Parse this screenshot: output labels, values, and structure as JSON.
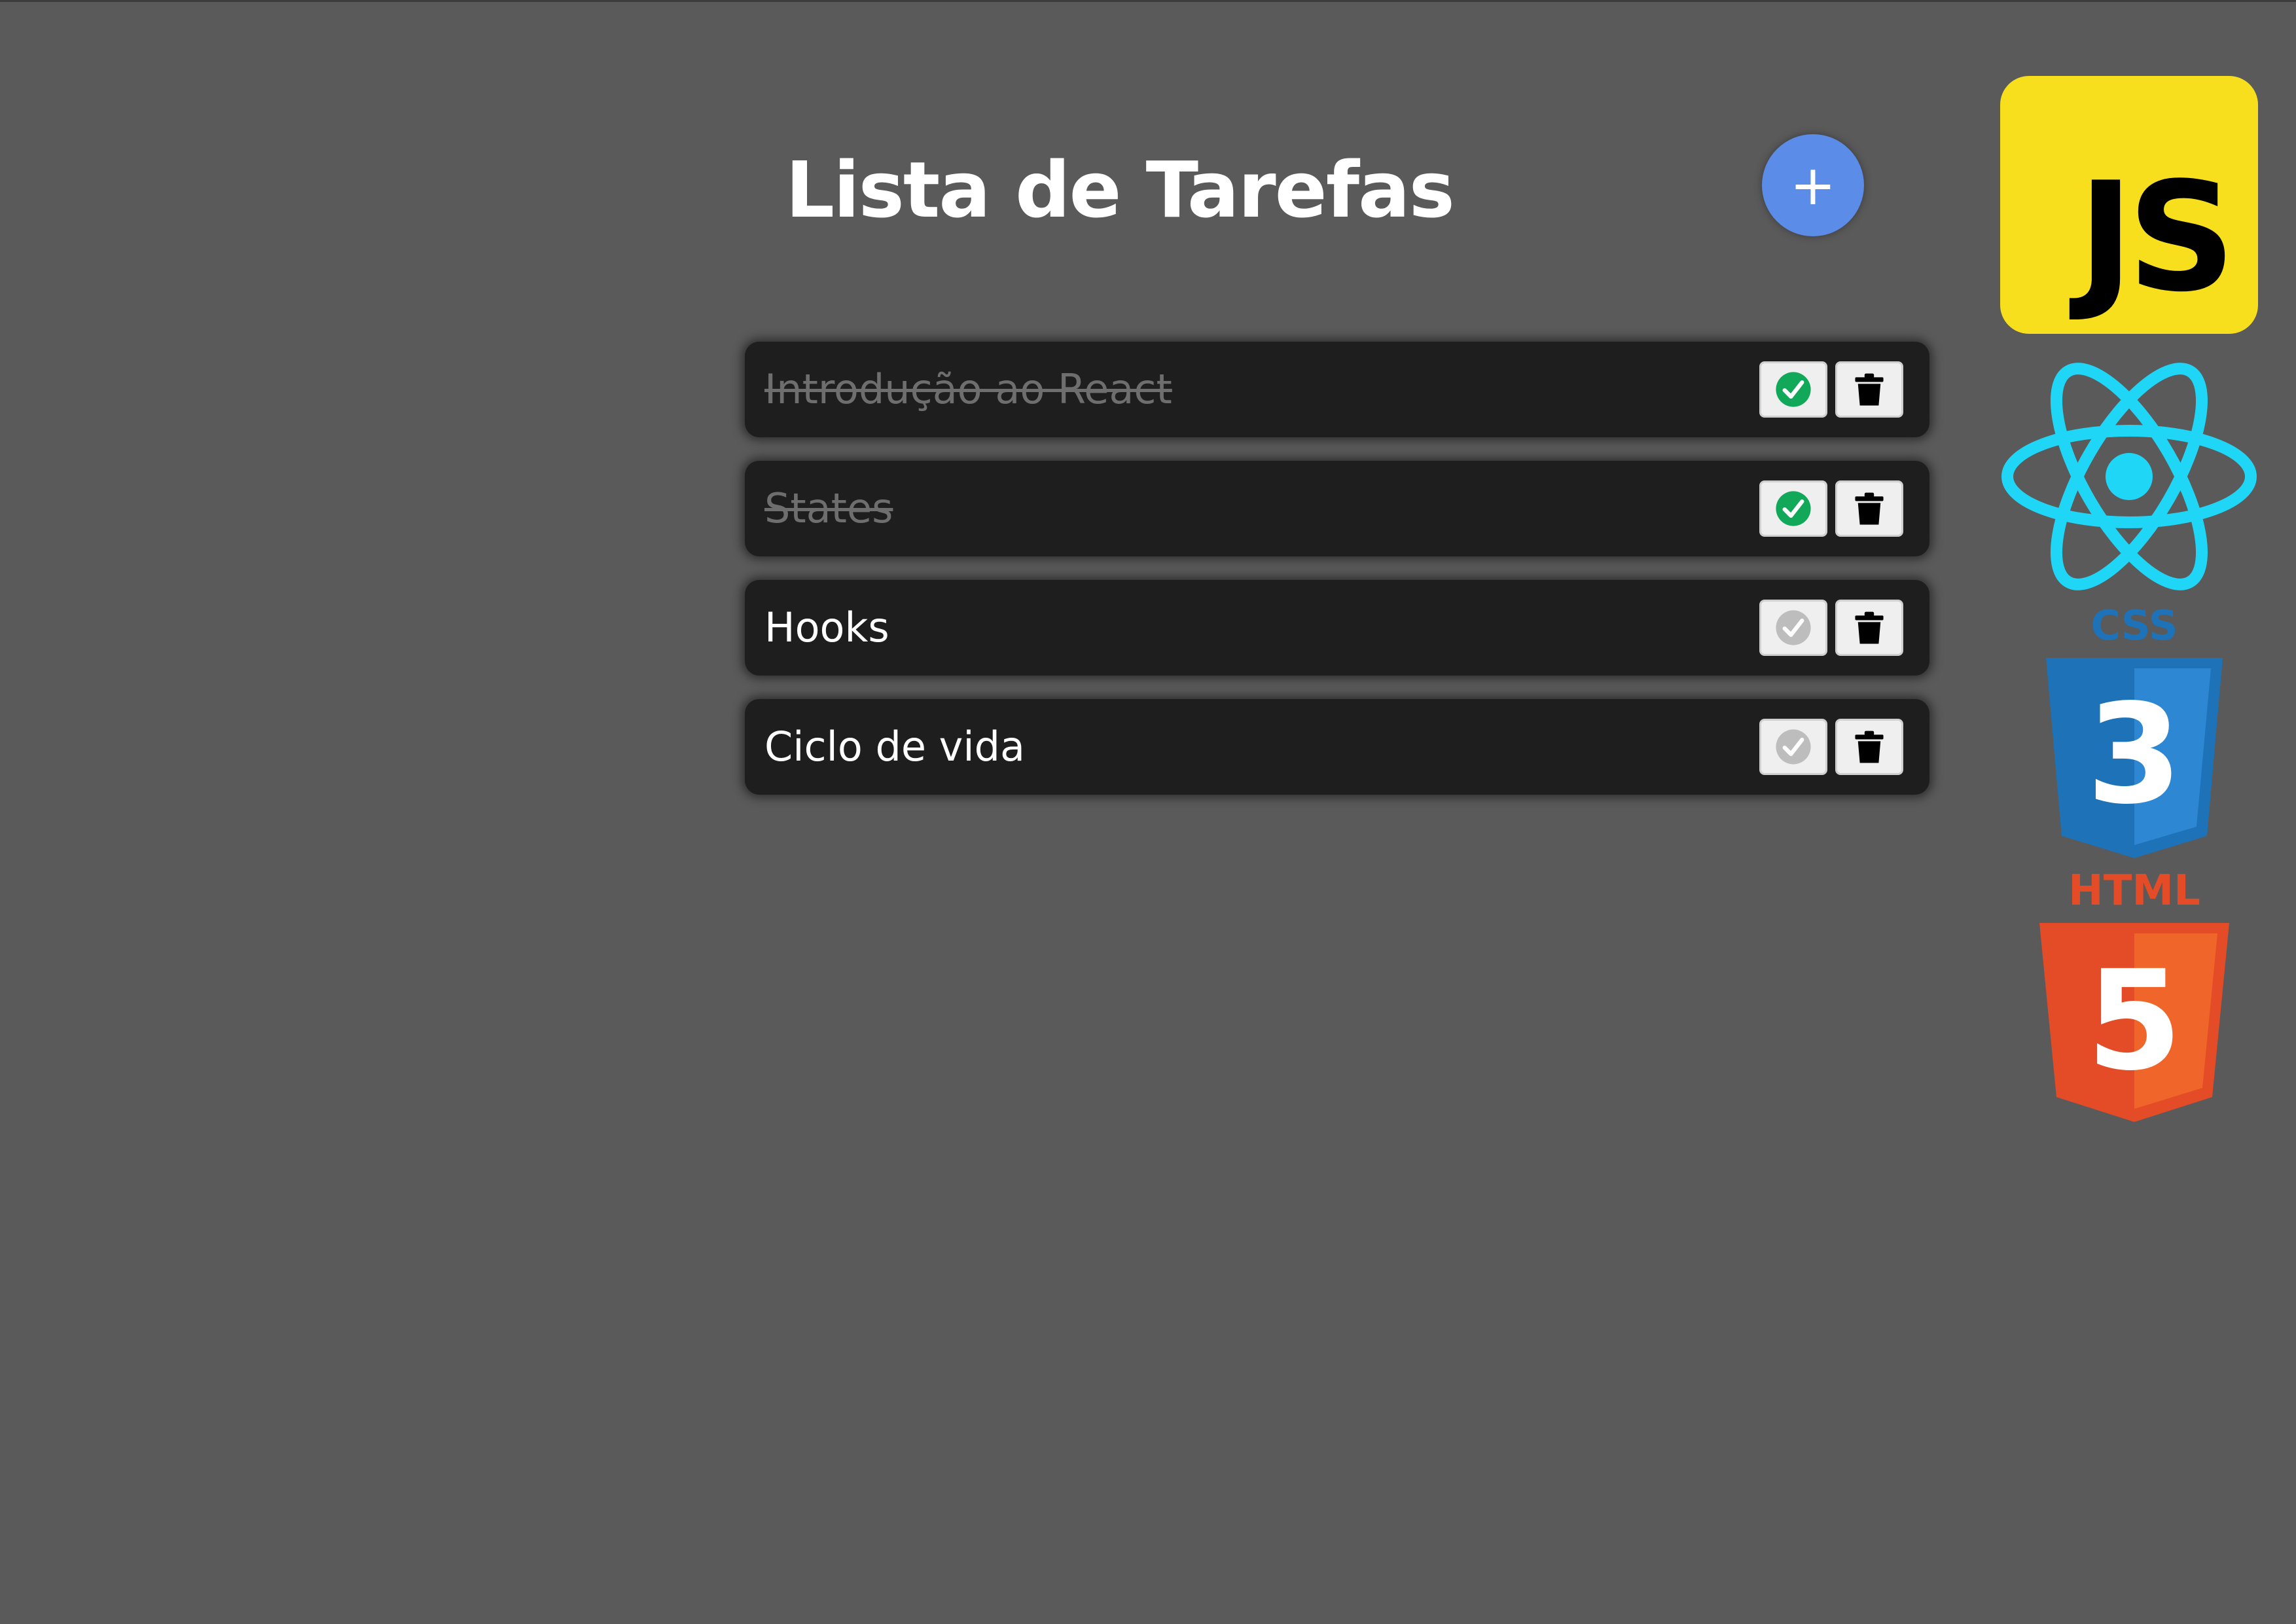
{
  "app": {
    "title": "Lista de Tarefas",
    "add_button_label": "+"
  },
  "tasks": [
    {
      "text": "Introdução ao React",
      "completed": true
    },
    {
      "text": "States",
      "completed": true
    },
    {
      "text": "Hooks",
      "completed": false
    },
    {
      "text": "Ciclo de vida",
      "completed": false
    }
  ],
  "tech_logos": {
    "js": "JS",
    "css": "CSS",
    "html": "HTML",
    "css_badge": "3",
    "html_badge": "5"
  },
  "colors": {
    "background": "#5a5a5a",
    "task_background": "#1e1e1e",
    "add_button": "#5b8ce8",
    "check_done": "#12a85a",
    "check_pending": "#bdbdbd",
    "js_logo": "#f7df1e",
    "react_logo": "#1fd6f7",
    "css_logo": "#1d72b8",
    "html_logo": "#e34c26"
  },
  "icons": {
    "check": "check-circle-icon",
    "delete": "trash-icon"
  }
}
